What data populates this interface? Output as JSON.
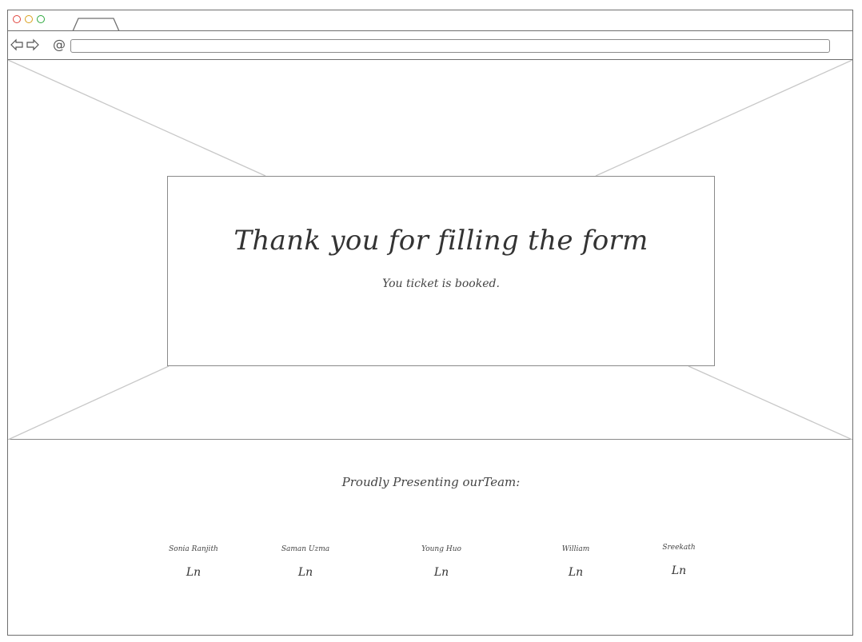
{
  "window": {
    "address": ""
  },
  "hero": {
    "title": "Thank you for filling the form",
    "subtitle": "You ticket is booked."
  },
  "team": {
    "heading": "Proudly Presenting ourTeam:",
    "members": [
      {
        "name": "Sonia Ranjith",
        "icon": "Ln"
      },
      {
        "name": "Saman Uzma",
        "icon": "Ln"
      },
      {
        "name": "Young Huo",
        "icon": "Ln"
      },
      {
        "name": "William",
        "icon": "Ln"
      },
      {
        "name": "Sreekath",
        "icon": "Ln"
      }
    ]
  },
  "colors": {
    "border": "#6f6f6f",
    "close": "#e0443e",
    "minimize": "#d9a01c",
    "maximize": "#2ba83b"
  }
}
